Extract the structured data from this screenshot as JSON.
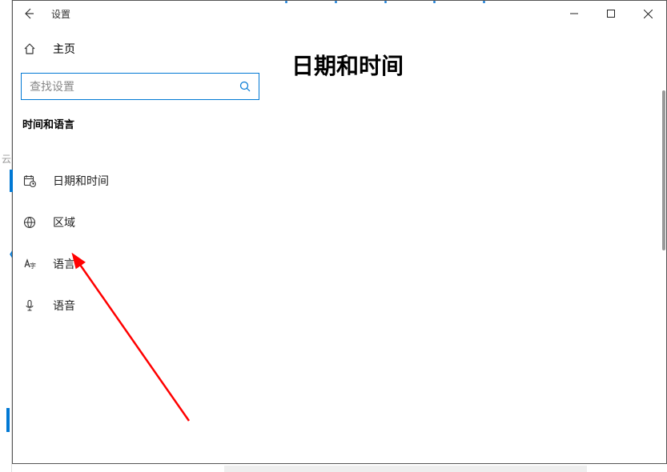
{
  "window": {
    "title": "设置"
  },
  "sidebar": {
    "home_label": "主页",
    "search_placeholder": "查找设置",
    "section_header": "时间和语言",
    "items": [
      {
        "label": "日期和时间",
        "active": true
      },
      {
        "label": "区域",
        "active": false
      },
      {
        "label": "语言",
        "active": false
      },
      {
        "label": "语音",
        "active": false
      }
    ]
  },
  "main": {
    "page_title": "日期和时间"
  }
}
